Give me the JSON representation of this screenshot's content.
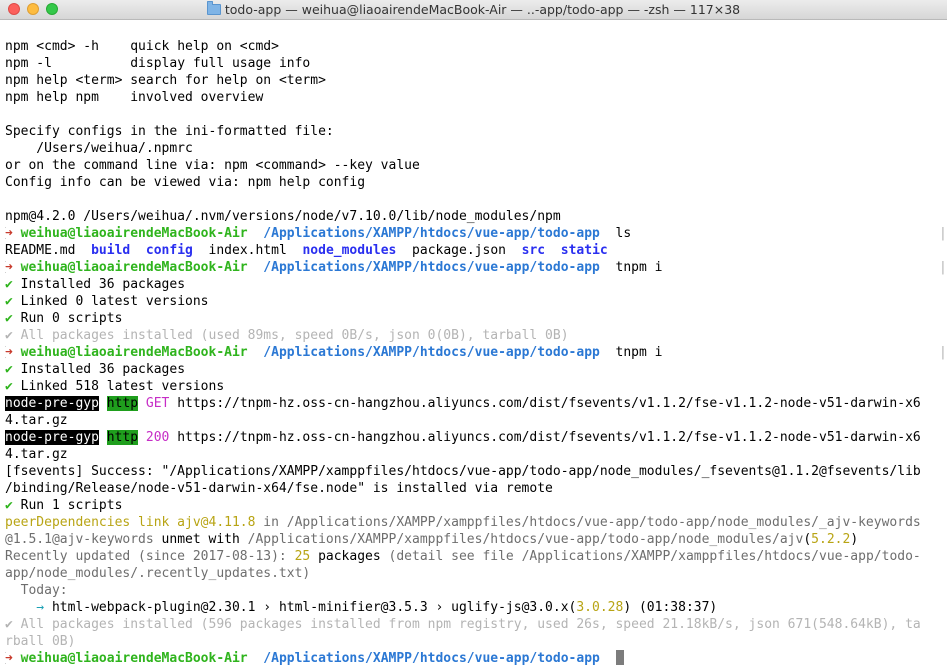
{
  "window": {
    "title": "todo-app — weihua@liaoairendeMacBook-Air — ..-app/todo-app — -zsh — 117×38"
  },
  "colors": {
    "prompt_user": "#2fb41d",
    "prompt_path": "#2b78d4",
    "arrow": "#c83a2c",
    "directory": "#2a2ff0",
    "check": "#2fb41d",
    "dim": "#b4b4b4"
  },
  "terminal": {
    "help": [
      {
        "cmd": "npm <cmd> -h    ",
        "desc": "quick help on <cmd>"
      },
      {
        "cmd": "npm -l          ",
        "desc": "display full usage info"
      },
      {
        "cmd": "npm help <term> ",
        "desc": "search for help on <term>"
      },
      {
        "cmd": "npm help npm    ",
        "desc": "involved overview"
      }
    ],
    "config": [
      "Specify configs in the ini-formatted file:",
      "    /Users/weihua/.npmrc",
      "or on the command line via: npm <command> --key value",
      "Config info can be viewed via: npm help config"
    ],
    "npm_version": "npm@4.2.0 /Users/weihua/.nvm/versions/node/v7.10.0/lib/node_modules/npm",
    "prompt": {
      "arrow": "➜",
      "user": "weihua@liaoairendeMacBook-Air",
      "path": "/Applications/XAMPP/htdocs/vue-app/todo-app",
      "bracket_left": "[",
      "bracket_right": "|"
    },
    "cmd_ls": "ls",
    "ls_output": {
      "readme": "README.md",
      "build": "build",
      "config": "config",
      "index": "index.html",
      "node_modules": "node_modules",
      "package": "package.json",
      "src": "src",
      "static": "static"
    },
    "cmd_tnpm1": "tnpm i",
    "run1": {
      "installed": "Installed 36 packages",
      "linked": "Linked 0 latest versions",
      "scripts": "Run 0 scripts",
      "all": "All packages installed (used 89ms, speed 0B/s, json 0(0B), tarball 0B)"
    },
    "cmd_tnpm2": "tnpm i",
    "run2": {
      "installed": "Installed 36 packages",
      "linked": "Linked 518 latest versions",
      "gyp_label": "node-pre-gyp",
      "http_label": "http",
      "get": "GET",
      "get_url": "https://tnpm-hz.oss-cn-hangzhou.aliyuncs.com/dist/fsevents/v1.1.2/fse-v1.1.2-node-v51-darwin-x6",
      "get_url_cont": "4.tar.gz",
      "status": "200",
      "ok_url": "https://tnpm-hz.oss-cn-hangzhou.aliyuncs.com/dist/fsevents/v1.1.2/fse-v1.1.2-node-v51-darwin-x6",
      "ok_url_cont": "4.tar.gz",
      "fsevents_1": "[fsevents] Success: \"/Applications/XAMPP/xamppfiles/htdocs/vue-app/todo-app/node_modules/_fsevents@1.1.2@fsevents/lib",
      "fsevents_2": "/binding/Release/node-v51-darwin-x64/fse.node\" is installed via remote",
      "scripts": "Run 1 scripts",
      "peer_a": "peerDependencies link ajv@4.11.8",
      "peer_b": " in /Applications/XAMPP/xamppfiles/htdocs/vue-app/todo-app/node_modules/_ajv-keywords",
      "peer2_a": "@1.5.1@ajv-keywords",
      "peer2_b": " unmet with ",
      "peer2_c": "/Applications/XAMPP/xamppfiles/htdocs/vue-app/todo-app/node_modules/ajv",
      "peer2_d": "(",
      "peer2_e": "5.2.2",
      "peer2_f": ")",
      "recent_a": "Recently updated (since 2017-08-13): ",
      "recent_count": "25",
      "recent_b": " packages ",
      "recent_c": "(detail see file /Applications/XAMPP/xamppfiles/htdocs/vue-app/todo-",
      "recent_d": "app/node_modules/.recently_updates.txt)",
      "today": "  Today:",
      "chain_arrow": "    →",
      "chain_a": " html-webpack-plugin@2.30.1 › html-minifier@3.5.3 › uglify-js@3.0.x(",
      "chain_ver": "3.0.28",
      "chain_b": ") (01:38:37)",
      "all_1": "All packages installed (596 packages installed from npm registry, used 26s, speed 21.18kB/s, json 671(548.64kB), ta",
      "all_2": "rball 0B)"
    },
    "check": "✔"
  }
}
